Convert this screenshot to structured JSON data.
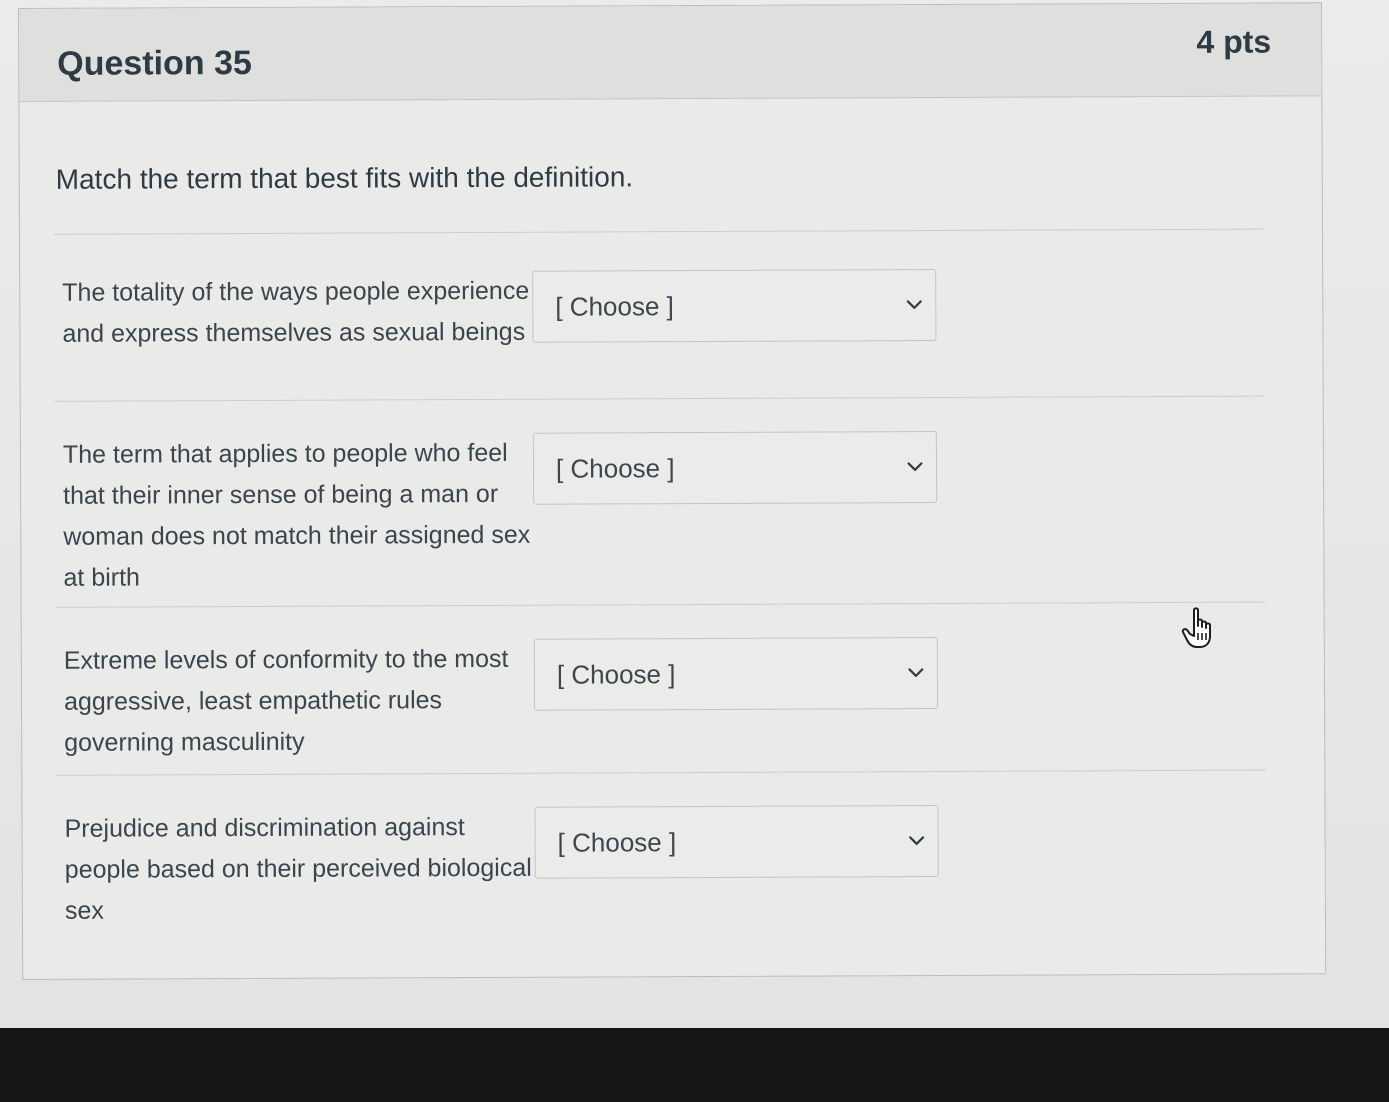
{
  "question": {
    "title": "Question 35",
    "points": "4 pts",
    "prompt": "Match the term that best fits with the definition."
  },
  "matches": [
    {
      "term": "The totality of the ways people experience and express themselves as sexual beings",
      "selected": "[ Choose ]"
    },
    {
      "term": "The term that applies to people who feel that their inner sense of being a man or woman does not match their assigned sex at birth",
      "selected": "[ Choose ]"
    },
    {
      "term": "Extreme levels of conformity to the most aggressive, least empathetic rules governing masculinity",
      "selected": "[ Choose ]"
    },
    {
      "term": "Prejudice and discrimination against people based on their perceived biological sex",
      "selected": "[ Choose ]"
    }
  ],
  "icons": {
    "dropdown": "chevron-down-icon",
    "cursor": "hand-pointer-icon"
  }
}
